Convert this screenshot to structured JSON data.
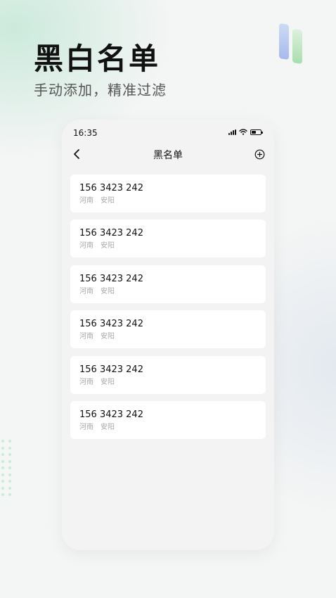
{
  "promo": {
    "title": "黑白名单",
    "subtitle": "手动添加，精准过滤"
  },
  "status_bar": {
    "time": "16:35",
    "icons": [
      "signal-icon",
      "wifi-icon",
      "battery-icon"
    ]
  },
  "nav": {
    "title": "黑名单",
    "back_icon": "chevron-left-icon",
    "add_icon": "plus-circle-icon"
  },
  "blacklist": [
    {
      "number": "156 3423 242",
      "province": "河南",
      "city": "安阳"
    },
    {
      "number": "156 3423 242",
      "province": "河南",
      "city": "安阳"
    },
    {
      "number": "156 3423 242",
      "province": "河南",
      "city": "安阳"
    },
    {
      "number": "156 3423 242",
      "province": "河南",
      "city": "安阳"
    },
    {
      "number": "156 3423 242",
      "province": "河南",
      "city": "安阳"
    },
    {
      "number": "156 3423 242",
      "province": "河南",
      "city": "安阳"
    }
  ],
  "colors": {
    "accent_green": "#c9ecd9",
    "card_bg": "#ffffff",
    "secondary_text": "#a9a9a9"
  }
}
